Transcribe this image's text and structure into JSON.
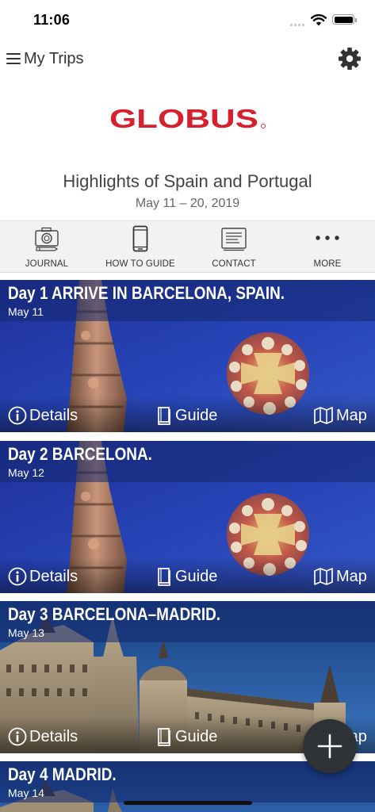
{
  "status_bar": {
    "time": "11:06"
  },
  "nav": {
    "menu_label": "My Trips"
  },
  "brand": {
    "logo_text": "GLOBUS",
    "color": "#d6202d"
  },
  "trip": {
    "title": "Highlights of Spain and Portugal",
    "dates": "May 11 – 20, 2019"
  },
  "toolbar": {
    "items": [
      {
        "label": "JOURNAL",
        "icon": "camera-icon"
      },
      {
        "label": "HOW TO GUIDE",
        "icon": "phone-icon"
      },
      {
        "label": "CONTACT",
        "icon": "contact-card-icon"
      },
      {
        "label": "MORE",
        "icon": "more-dots-icon"
      }
    ]
  },
  "days": [
    {
      "title": "Day 1 ARRIVE IN BARCELONA, SPAIN.",
      "date": "May 11",
      "image": "sagrada-familia"
    },
    {
      "title": "Day 2 BARCELONA.",
      "date": "May 12",
      "image": "sagrada-familia"
    },
    {
      "title": "Day 3 BARCELONA–MADRID.",
      "date": "May 13",
      "image": "el-escorial"
    },
    {
      "title": "Day 4 MADRID.",
      "date": "May 14",
      "image": "el-escorial"
    }
  ],
  "actions": {
    "details": "Details",
    "guide": "Guide",
    "map": "Map"
  },
  "fab": {
    "icon": "plus-icon"
  }
}
